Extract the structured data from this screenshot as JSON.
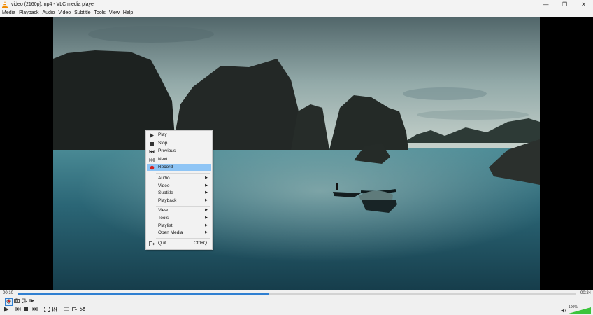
{
  "window": {
    "title": "video (2160p).mp4 - VLC media player",
    "minimize_icon": "minimize-icon",
    "maximize_icon": "maximize-icon",
    "close_icon": "close-icon"
  },
  "menubar": [
    "Media",
    "Playback",
    "Audio",
    "Video",
    "Subtitle",
    "Tools",
    "View",
    "Help"
  ],
  "context_menu": {
    "items": [
      {
        "label": "Play",
        "icon": "play-icon"
      },
      {
        "label": "Stop",
        "icon": "stop-icon"
      },
      {
        "label": "Previous",
        "icon": "previous-icon"
      },
      {
        "label": "Next",
        "icon": "next-icon"
      },
      {
        "label": "Record",
        "icon": "record-icon",
        "highlighted": true
      },
      {
        "label": "Audio",
        "submenu": true
      },
      {
        "label": "Video",
        "submenu": true
      },
      {
        "label": "Subtitle",
        "submenu": true
      },
      {
        "label": "Playback",
        "submenu": true
      },
      {
        "label": "View",
        "submenu": true
      },
      {
        "label": "Tools",
        "submenu": true
      },
      {
        "label": "Playlist",
        "submenu": true
      },
      {
        "label": "Open Media",
        "submenu": true
      },
      {
        "label": "Quit",
        "icon": "quit-icon",
        "shortcut": "Ctrl+Q"
      }
    ]
  },
  "playback": {
    "elapsed": "00:10",
    "duration": "00:24",
    "progress": 0.45
  },
  "volume": {
    "level_text": "100%",
    "level": 1.0
  },
  "colors": {
    "accent": "#2f7fd1",
    "highlight": "#8fc5f5",
    "record_dot": "#d32020",
    "volume_green": "#3cc43c"
  }
}
